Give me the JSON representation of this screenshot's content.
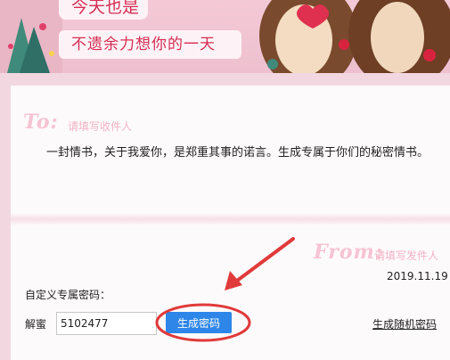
{
  "banner": {
    "line1": "今天也是",
    "line2": "不遗余力想你的一天"
  },
  "letter": {
    "to_label": "To:",
    "to_placeholder": "请填写收件人",
    "body": "一封情书，关于我爱你，是郑重其事的诺言。生成专属于你们的秘密情书。",
    "from_label": "From:",
    "from_placeholder": "请填写发件人",
    "date": "2019.11.19"
  },
  "password": {
    "title": "自定义专属密码：",
    "field_label": "解蜜",
    "value": "5102477",
    "generate_label": "生成密码",
    "random_label": "生成随机密码"
  },
  "colors": {
    "accent": "#2e86e8",
    "annotation": "#e03a3a",
    "banner_text": "#d62c54",
    "placeholder": "#f3b2c6"
  }
}
